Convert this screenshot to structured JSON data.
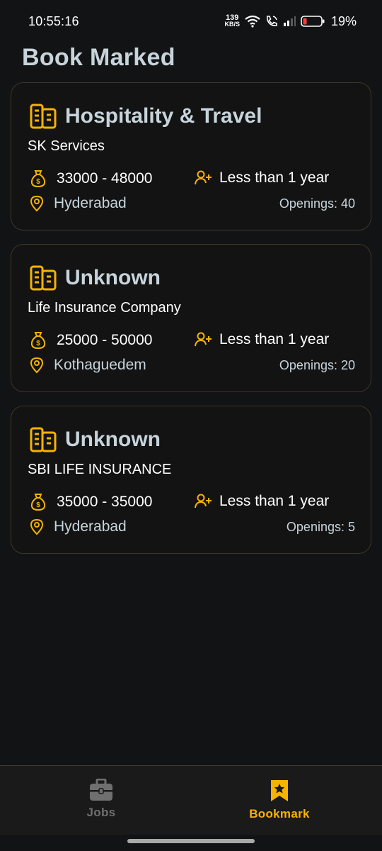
{
  "status_bar": {
    "time": "10:55:16",
    "net_speed_value": "139",
    "net_speed_unit": "KB/S",
    "battery": "19%"
  },
  "page": {
    "title": "Book Marked"
  },
  "colors": {
    "accent": "#f6b300",
    "title_text": "#c7d4db",
    "card_border": "#3d3626",
    "background": "#121314"
  },
  "jobs": [
    {
      "category": "Hospitality & Travel",
      "company": "SK Services",
      "salary": "33000 - 48000",
      "experience": "Less than 1 year",
      "location": "Hyderabad",
      "openings": "Openings: 40"
    },
    {
      "category": "Unknown",
      "company": "Life Insurance Company",
      "salary": "25000 - 50000",
      "experience": "Less than 1 year",
      "location": "Kothaguedem",
      "openings": "Openings: 20"
    },
    {
      "category": "Unknown",
      "company": "SBI LIFE INSURANCE",
      "salary": "35000 - 35000",
      "experience": "Less than 1 year",
      "location": "Hyderabad",
      "openings": "Openings: 5"
    }
  ],
  "icons": {
    "category": "building-icon",
    "salary": "money-bag-icon",
    "experience": "person-add-icon",
    "location": "location-pin-icon"
  },
  "bottom_nav": {
    "items": [
      {
        "label": "Jobs",
        "icon": "briefcase-icon",
        "active": false
      },
      {
        "label": "Bookmark",
        "icon": "bookmark-icon",
        "active": true
      }
    ]
  }
}
